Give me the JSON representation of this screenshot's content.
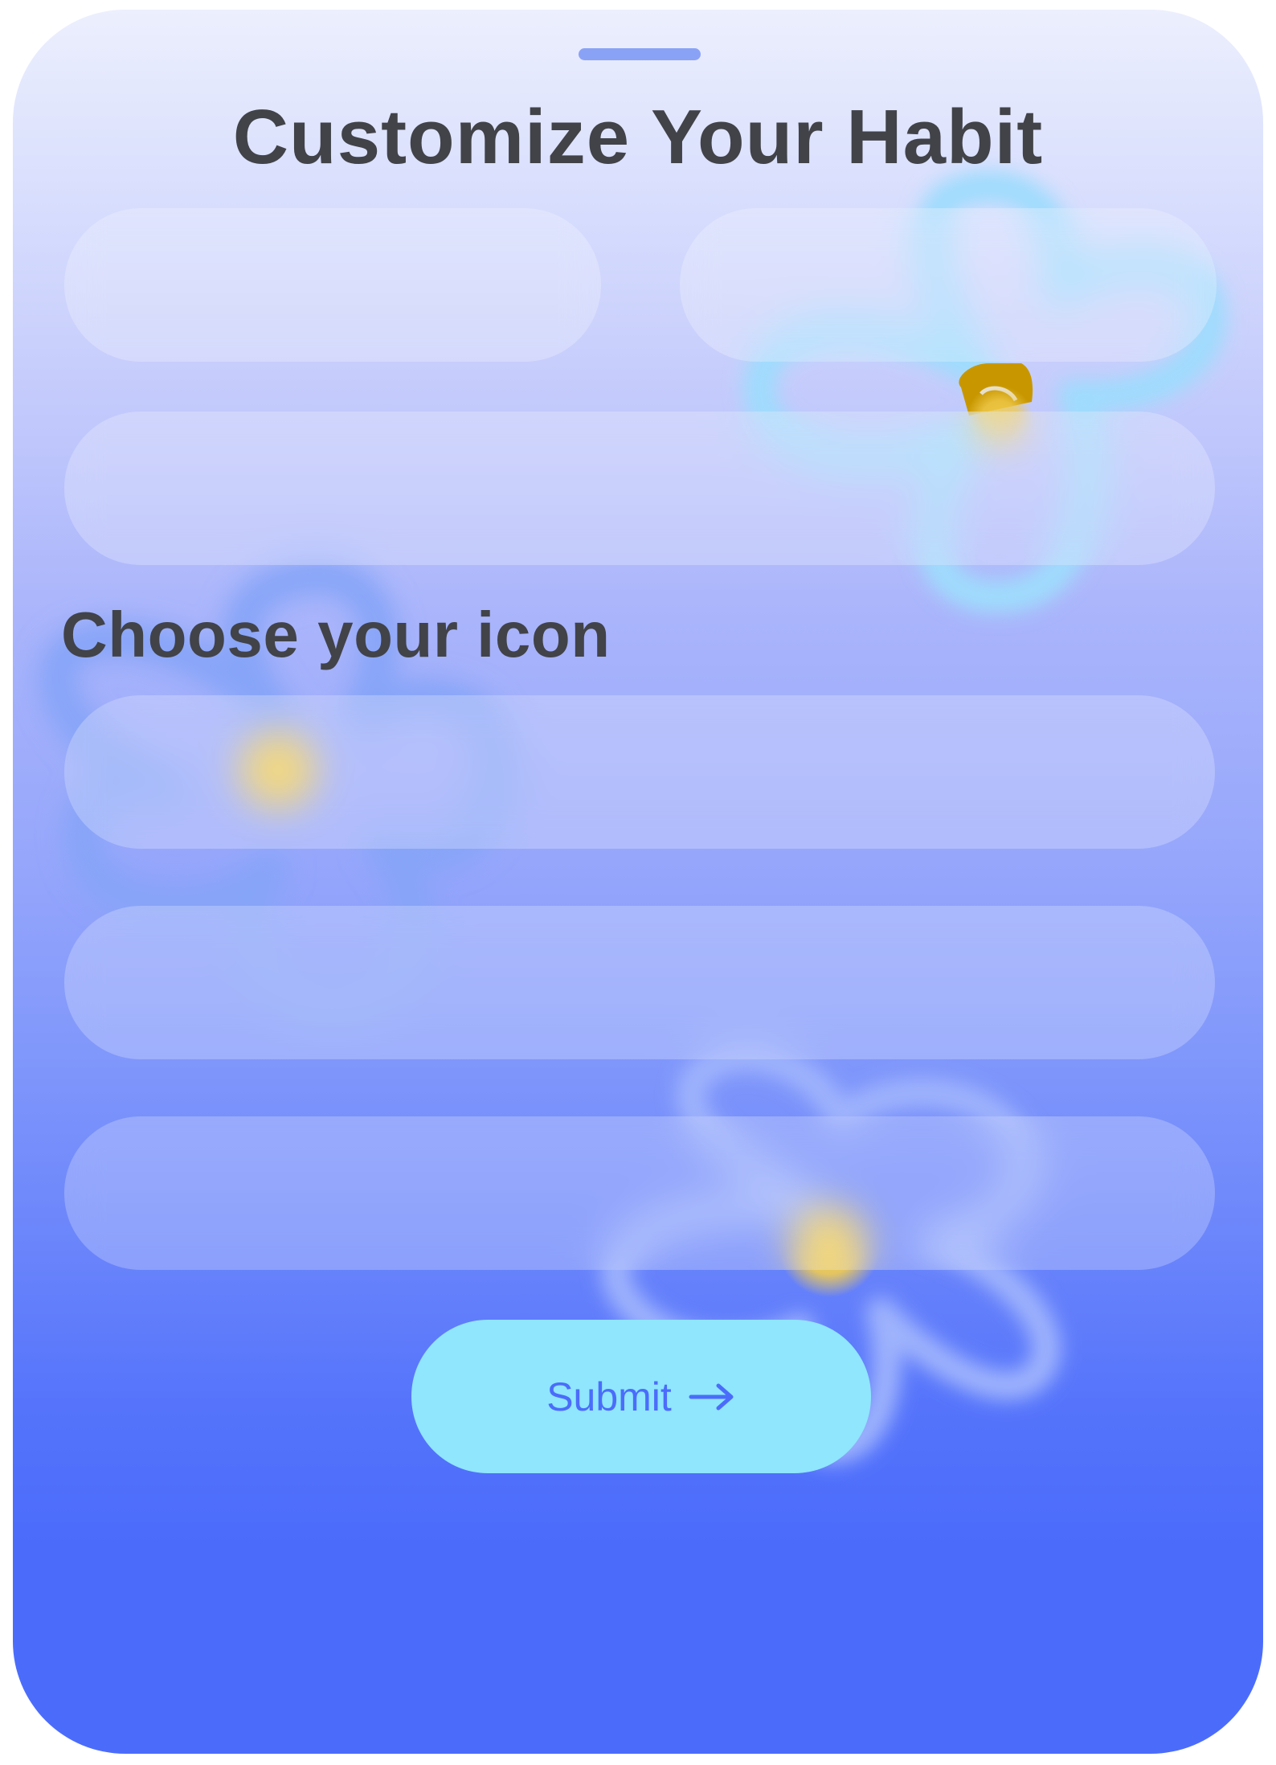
{
  "sheet": {
    "title": "Customize Your Habit",
    "fields": {
      "name": "",
      "category": "",
      "description": ""
    },
    "icon_section": {
      "heading": "Choose your icon",
      "options": [
        "",
        "",
        ""
      ]
    },
    "submit_label": "Submit"
  },
  "colors": {
    "accent": "#4b6cfb",
    "submit_bg": "#8fe6fd",
    "title_text": "#414349",
    "gradient_top": "#eceffd",
    "gradient_bottom": "#4b6cfb",
    "flower_center": "#f5cd48"
  },
  "icons": {
    "submit_arrow": "arrow-right-icon",
    "decor": "flower-icon"
  }
}
